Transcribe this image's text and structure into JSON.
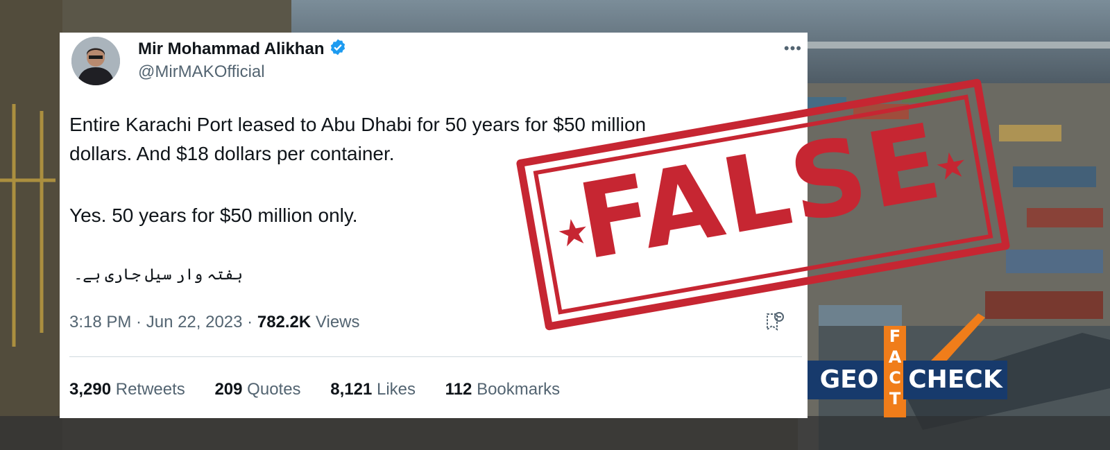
{
  "tweet": {
    "display_name": "Mir Mohammad Alikhan",
    "handle": "@MirMAKOfficial",
    "lines": [
      "Entire Karachi Port leased to Abu Dhabi for 50 years for $50 million",
      "dollars. And $18 dollars per container.",
      "Yes. 50 years for $50 million only."
    ],
    "urdu_line": "ہفتہ وار سیل جاری ہے۔",
    "time": "3:18 PM",
    "date": "Jun 22, 2023",
    "views_count": "782.2K",
    "views_label": "Views",
    "stats": [
      {
        "count": "3,290",
        "label": "Retweets"
      },
      {
        "count": "209",
        "label": "Quotes"
      },
      {
        "count": "8,121",
        "label": "Likes"
      },
      {
        "count": "112",
        "label": "Bookmarks"
      }
    ]
  },
  "stamp": {
    "word": "FALSE",
    "star": "★"
  },
  "logo": {
    "left": "GEO",
    "middle_letters": [
      "F",
      "A",
      "C",
      "T"
    ],
    "right": "CHECK"
  },
  "colors": {
    "stamp_red": "#c62632",
    "logo_blue": "#173a6c",
    "logo_orange": "#f07d1a",
    "verified_blue": "#1d9bf0"
  },
  "icons": [
    "verified-badge-icon",
    "more-options-icon",
    "bookmark-icon"
  ]
}
